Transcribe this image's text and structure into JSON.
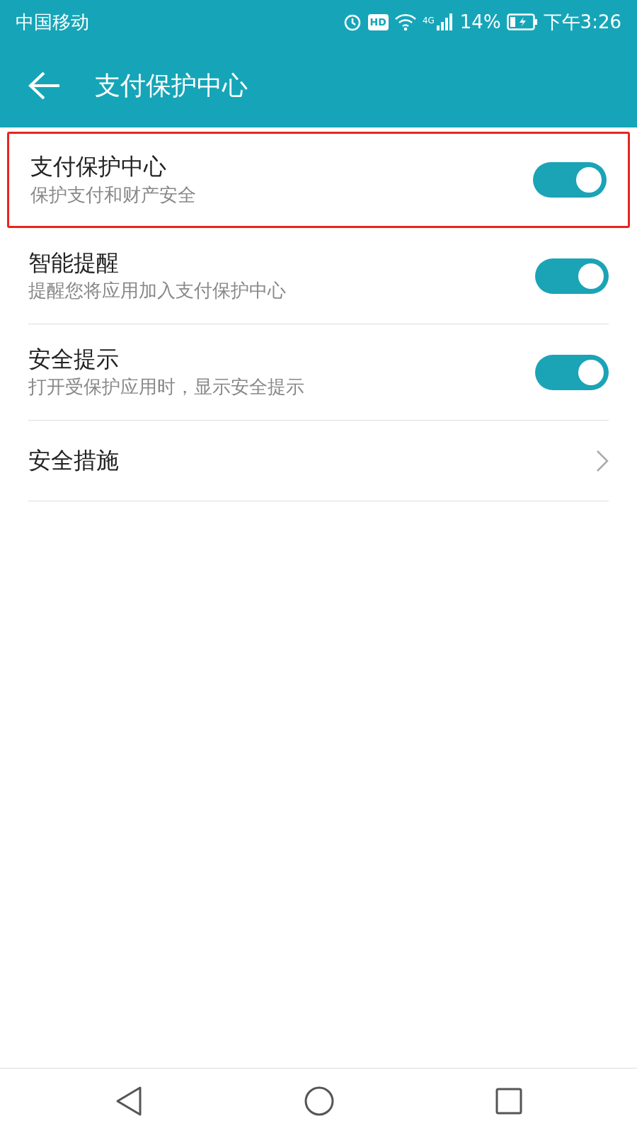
{
  "status_bar": {
    "carrier": "中国移动",
    "hd": "HD",
    "network": "4G",
    "battery": "14%",
    "time": "下午3:26"
  },
  "app_bar": {
    "title": "支付保护中心"
  },
  "settings": [
    {
      "kind": "toggle",
      "title": "支付保护中心",
      "subtitle": "保护支付和财产安全",
      "on": true,
      "highlighted": true
    },
    {
      "kind": "toggle",
      "title": "智能提醒",
      "subtitle": "提醒您将应用加入支付保护中心",
      "on": true,
      "highlighted": false
    },
    {
      "kind": "toggle",
      "title": "安全提示",
      "subtitle": "打开受保护应用时，显示安全提示",
      "on": true,
      "highlighted": false
    },
    {
      "kind": "link",
      "title": "安全措施",
      "highlighted": false
    }
  ]
}
